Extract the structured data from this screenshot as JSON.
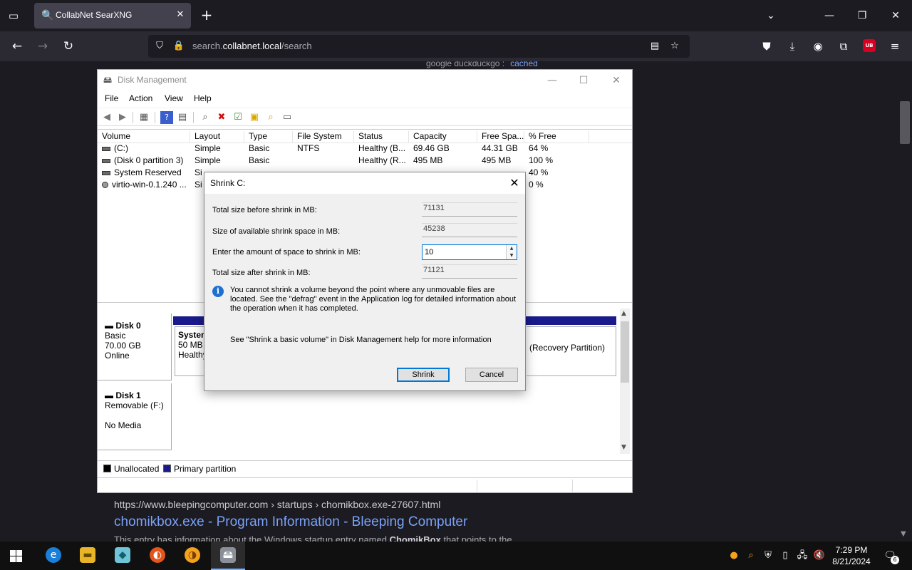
{
  "browser": {
    "tab_title": "CollabNet SearXNG",
    "url_prefix": "search.",
    "url_host": "collabnet.local",
    "url_path": "/search",
    "extension_badge": "UB"
  },
  "page": {
    "engines": "google  duckduckgo  :",
    "cached": "cached",
    "result_url": "https://www.bleepingcomputer.com  › startups › chomikbox.exe-27607.html",
    "result_title": "chomikbox.exe - Program Information - Bleeping Computer",
    "result_snippet_start": "This entry has information about the Windows startup entry named ",
    "result_snippet_bold": "ChomikBox",
    "result_snippet_end": " that points to the"
  },
  "disk_management": {
    "title": "Disk Management",
    "menu": [
      "File",
      "Action",
      "View",
      "Help"
    ],
    "columns": [
      "Volume",
      "Layout",
      "Type",
      "File System",
      "Status",
      "Capacity",
      "Free Spa...",
      "% Free"
    ],
    "volumes": [
      {
        "volume": "(C:)",
        "layout": "Simple",
        "type": "Basic",
        "fs": "NTFS",
        "status": "Healthy (B...",
        "capacity": "69.46 GB",
        "free": "44.31 GB",
        "pct": "64 %"
      },
      {
        "volume": "(Disk 0 partition 3)",
        "layout": "Simple",
        "type": "Basic",
        "fs": "",
        "status": "Healthy (R...",
        "capacity": "495 MB",
        "free": "495 MB",
        "pct": "100 %"
      },
      {
        "volume": "System Reserved",
        "layout": "Si",
        "type": "",
        "fs": "",
        "status": "",
        "capacity": "",
        "free": "",
        "pct": "40 %"
      },
      {
        "volume": "virtio-win-0.1.240 ...",
        "layout": "Si",
        "type": "",
        "fs": "",
        "status": "",
        "capacity": "",
        "free": "",
        "pct": "0 %"
      }
    ],
    "disks": [
      {
        "name": "Disk 0",
        "kind": "Basic",
        "size": "70.00 GB",
        "state": "Online"
      },
      {
        "name": "Disk 1",
        "kind": "Removable (F:)",
        "size": "",
        "state": "No Media"
      }
    ],
    "partition_system": {
      "name": "System",
      "size": "50 MB",
      "status": "Healthy"
    },
    "partition_recovery": "(Recovery Partition)",
    "legend": [
      {
        "label": "Unallocated",
        "color": "#000000"
      },
      {
        "label": "Primary partition",
        "color": "#1a1a8c"
      }
    ]
  },
  "dialog": {
    "title": "Shrink C:",
    "total_before_label": "Total size before shrink in MB:",
    "total_before_value": "71131",
    "available_label": "Size of available shrink space in MB:",
    "available_value": "45238",
    "amount_label": "Enter the amount of space to shrink in MB:",
    "amount_value": "10",
    "total_after_label": "Total size after shrink in MB:",
    "total_after_value": "71121",
    "info": "You cannot shrink a volume beyond the point where any unmovable files are located. See the \"defrag\" event in the Application log for detailed information about the operation when it has completed.",
    "help": "See \"Shrink a basic volume\" in Disk Management help for more information",
    "shrink_label": "Shrink",
    "cancel_label": "Cancel"
  },
  "taskbar": {
    "time": "7:29 PM",
    "date": "8/21/2024",
    "notification_count": "6"
  },
  "colors": {
    "accent": "#0078d7",
    "primary_partition": "#1a1a8c",
    "browser_bg": "#1c1b22",
    "link": "#7aa2f7"
  }
}
